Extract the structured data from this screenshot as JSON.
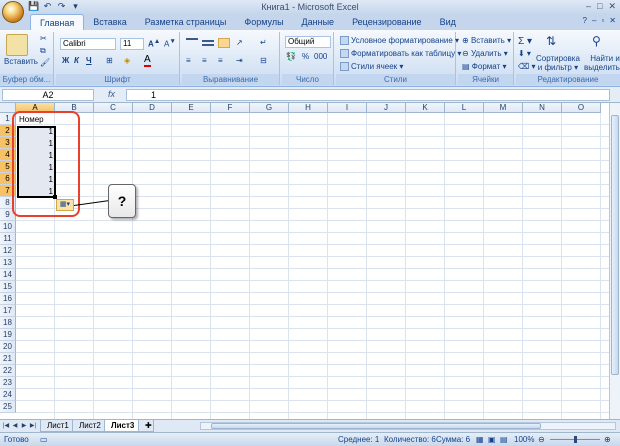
{
  "window": {
    "title": "Книга1 - Microsoft Excel",
    "controls": [
      "–",
      "□",
      "✕"
    ]
  },
  "qat": [
    "💾",
    "↶",
    "↷",
    "▾"
  ],
  "tabs": [
    {
      "label": "Главная",
      "active": true
    },
    {
      "label": "Вставка",
      "active": false
    },
    {
      "label": "Разметка страницы",
      "active": false
    },
    {
      "label": "Формулы",
      "active": false
    },
    {
      "label": "Данные",
      "active": false
    },
    {
      "label": "Рецензирование",
      "active": false
    },
    {
      "label": "Вид",
      "active": false
    }
  ],
  "ribbon": {
    "clipboard": {
      "label": "Буфер обм...",
      "paste": "Вставить"
    },
    "font": {
      "label": "Шрифт",
      "name": "Calibri",
      "size": "11",
      "bold": "Ж",
      "italic": "К",
      "underline": "Ч"
    },
    "alignment": {
      "label": "Выравнивание"
    },
    "number": {
      "label": "Число",
      "format": "Общий",
      "percent": "%",
      "thousands": "000"
    },
    "styles": {
      "label": "Стили",
      "conditional": "Условное форматирование",
      "table": "Форматировать как таблицу",
      "cell": "Стили ячеек"
    },
    "cells": {
      "label": "Ячейки",
      "insert": "Вставить",
      "delete": "Удалить",
      "format": "Формат"
    },
    "editing": {
      "label": "Редактирование",
      "sort": "Сортировка",
      "sort2": "и фильтр",
      "find": "Найти и",
      "find2": "выделить"
    }
  },
  "formula_bar": {
    "name_box": "A2",
    "fx": "fx",
    "content": "1"
  },
  "columns": [
    "A",
    "B",
    "C",
    "D",
    "E",
    "F",
    "G",
    "H",
    "I",
    "J",
    "K",
    "L",
    "M",
    "N",
    "O"
  ],
  "rows": [
    "1",
    "2",
    "3",
    "4",
    "5",
    "6",
    "7",
    "8",
    "9",
    "10",
    "11",
    "12",
    "13",
    "14",
    "15",
    "16",
    "17",
    "18",
    "19",
    "20",
    "21",
    "22",
    "23",
    "24",
    "25"
  ],
  "cells": {
    "A1": "Номер",
    "A2": "1",
    "A3": "1",
    "A4": "1",
    "A5": "1",
    "A6": "1",
    "A7": "1"
  },
  "callout": "?",
  "sheets": [
    {
      "label": "Лист1",
      "active": false
    },
    {
      "label": "Лист2",
      "active": false
    },
    {
      "label": "Лист3",
      "active": true
    }
  ],
  "status": {
    "ready": "Готово",
    "average": "Среднее: 1",
    "count": "Количество: 6",
    "sum": "Сумма: 6",
    "zoom": "100%"
  }
}
